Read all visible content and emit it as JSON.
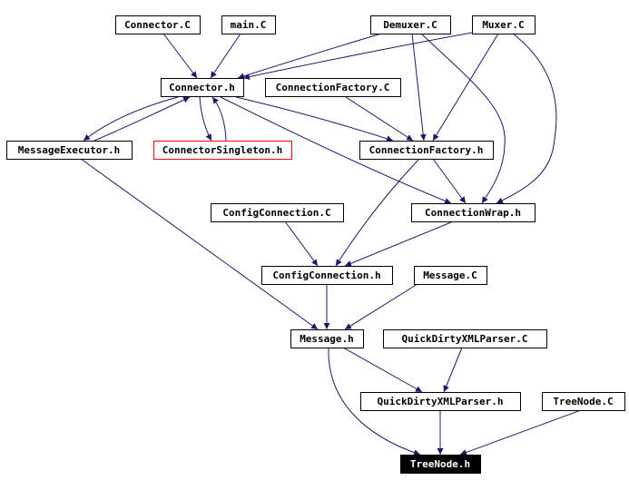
{
  "colors": {
    "edge": "#191970",
    "highlight_border": "#ff0000",
    "root_fill": "#000000"
  },
  "nodes": [
    {
      "id": "connector_c",
      "label": "Connector.C"
    },
    {
      "id": "main_c",
      "label": "main.C"
    },
    {
      "id": "demuxer_c",
      "label": "Demuxer.C"
    },
    {
      "id": "muxer_c",
      "label": "Muxer.C"
    },
    {
      "id": "connector_h",
      "label": "Connector.h"
    },
    {
      "id": "connectionfactory_c",
      "label": "ConnectionFactory.C"
    },
    {
      "id": "messageexecutor_h",
      "label": "MessageExecutor.h"
    },
    {
      "id": "connectorsingleton_h",
      "label": "ConnectorSingleton.h",
      "style": "red"
    },
    {
      "id": "connectionfactory_h",
      "label": "ConnectionFactory.h"
    },
    {
      "id": "configconnection_c",
      "label": "ConfigConnection.C"
    },
    {
      "id": "connectionwrap_h",
      "label": "ConnectionWrap.h"
    },
    {
      "id": "configconnection_h",
      "label": "ConfigConnection.h"
    },
    {
      "id": "message_c",
      "label": "Message.C"
    },
    {
      "id": "message_h",
      "label": "Message.h"
    },
    {
      "id": "quickdirtyxmlparser_c",
      "label": "QuickDirtyXMLParser.C"
    },
    {
      "id": "quickdirtyxmlparser_h",
      "label": "QuickDirtyXMLParser.h"
    },
    {
      "id": "treenode_c",
      "label": "TreeNode.C"
    },
    {
      "id": "treenode_h",
      "label": "TreeNode.h",
      "style": "root"
    }
  ],
  "edges": [
    [
      "connector_c",
      "connector_h"
    ],
    [
      "main_c",
      "connector_h"
    ],
    [
      "demuxer_c",
      "connector_h"
    ],
    [
      "muxer_c",
      "connector_h"
    ],
    [
      "demuxer_c",
      "connectionfactory_h"
    ],
    [
      "demuxer_c",
      "connectionwrap_h"
    ],
    [
      "muxer_c",
      "connectionfactory_h"
    ],
    [
      "muxer_c",
      "connectionwrap_h"
    ],
    [
      "connectionfactory_c",
      "connectionfactory_h"
    ],
    [
      "connector_h",
      "messageexecutor_h"
    ],
    [
      "messageexecutor_h",
      "connector_h"
    ],
    [
      "connector_h",
      "connectorsingleton_h"
    ],
    [
      "connectorsingleton_h",
      "connector_h"
    ],
    [
      "connector_h",
      "connectionfactory_h"
    ],
    [
      "connector_h",
      "connectionwrap_h"
    ],
    [
      "connectionfactory_h",
      "connectionwrap_h"
    ],
    [
      "connectionfactory_h",
      "configconnection_h"
    ],
    [
      "configconnection_c",
      "configconnection_h"
    ],
    [
      "connectionwrap_h",
      "configconnection_h"
    ],
    [
      "messageexecutor_h",
      "message_h"
    ],
    [
      "configconnection_h",
      "message_h"
    ],
    [
      "message_c",
      "message_h"
    ],
    [
      "message_h",
      "quickdirtyxmlparser_h"
    ],
    [
      "message_h",
      "treenode_h"
    ],
    [
      "quickdirtyxmlparser_c",
      "quickdirtyxmlparser_h"
    ],
    [
      "quickdirtyxmlparser_h",
      "treenode_h"
    ],
    [
      "treenode_c",
      "treenode_h"
    ]
  ]
}
